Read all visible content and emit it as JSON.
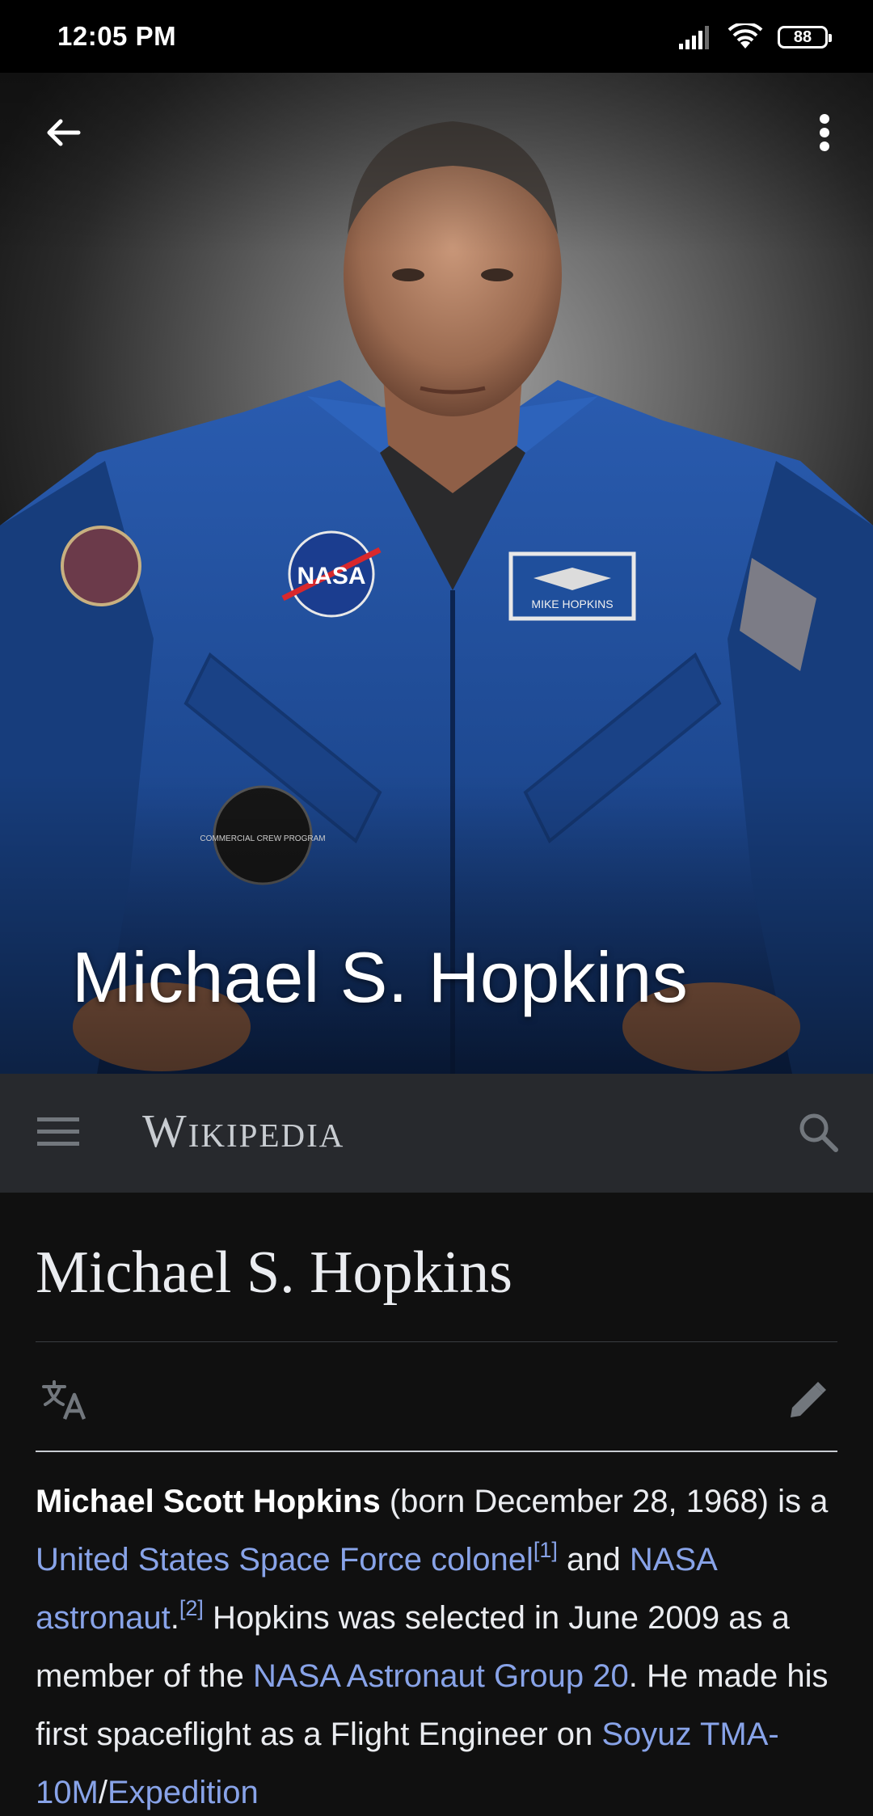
{
  "status_bar": {
    "time": "12:05 PM",
    "battery_level": "88"
  },
  "hero": {
    "title": "Michael S. Hopkins",
    "patch_name": "MIKE HOPKINS",
    "nasa_patch_text": "NASA",
    "crew_patch_text": "COMMERCIAL CREW PROGRAM"
  },
  "header": {
    "wordmark": "Wikipedia"
  },
  "article": {
    "title": "Michael S. Hopkins",
    "lead": {
      "bold_name": "Michael Scott Hopkins",
      "t1": " (born December 28, 1968) is a ",
      "link1": "United States Space Force colonel",
      "ref1": "[1]",
      "t2": " and ",
      "link2": "NASA astronaut",
      "t3": ".",
      "ref2": "[2]",
      "t4": " Hopkins was selected in June 2009 as a member of the ",
      "link3": "NASA Astronaut Group 20",
      "t5": ". He made his first spaceflight as a Flight Engineer on ",
      "link4": "Soyuz TMA-10M",
      "t6": "/",
      "link5": "Expedition"
    }
  },
  "colors": {
    "link": "#88a3e8",
    "header_bg": "#27292d",
    "page_bg": "#101010",
    "flight_suit": "#1f4f9c"
  }
}
